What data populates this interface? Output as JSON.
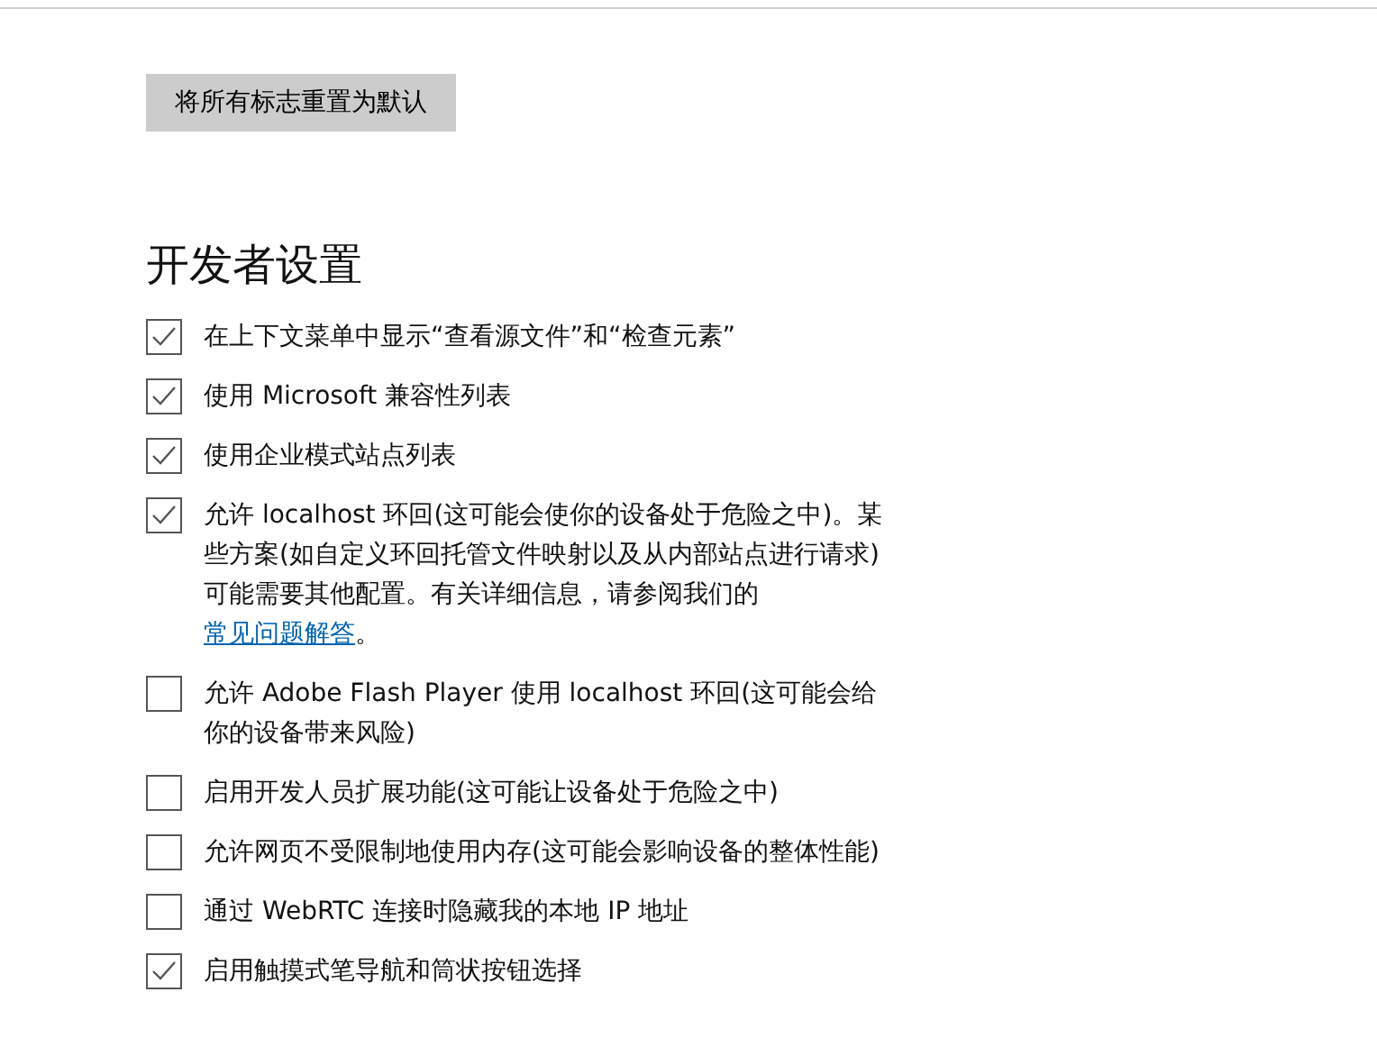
{
  "reset_button": "将所有标志重置为默认",
  "section_title": "开发者设置",
  "options": [
    {
      "label": "在上下文菜单中显示“查看源文件”和“检查元素”",
      "checked": true
    },
    {
      "label": "使用 Microsoft 兼容性列表",
      "checked": true
    },
    {
      "label": "使用企业模式站点列表",
      "checked": true
    },
    {
      "label": "允许 localhost 环回(这可能会使你的设备处于危险之中)。某些方案(如自定义环回托管文件映射以及从内部站点进行请求)可能需要其他配置。有关详细信息，请参阅我们的",
      "link": "常见问题解答",
      "after": "。",
      "checked": true
    },
    {
      "label": "允许 Adobe Flash Player 使用 localhost 环回(这可能会给你的设备带来风险)",
      "checked": false
    },
    {
      "label": "启用开发人员扩展功能(这可能让设备处于危险之中)",
      "checked": false
    },
    {
      "label": "允许网页不受限制地使用内存(这可能会影响设备的整体性能)",
      "checked": false
    },
    {
      "label": "通过 WebRTC 连接时隐藏我的本地 IP 地址",
      "checked": false
    },
    {
      "label": "启用触摸式笔导航和筒状按钮选择",
      "checked": true
    }
  ]
}
